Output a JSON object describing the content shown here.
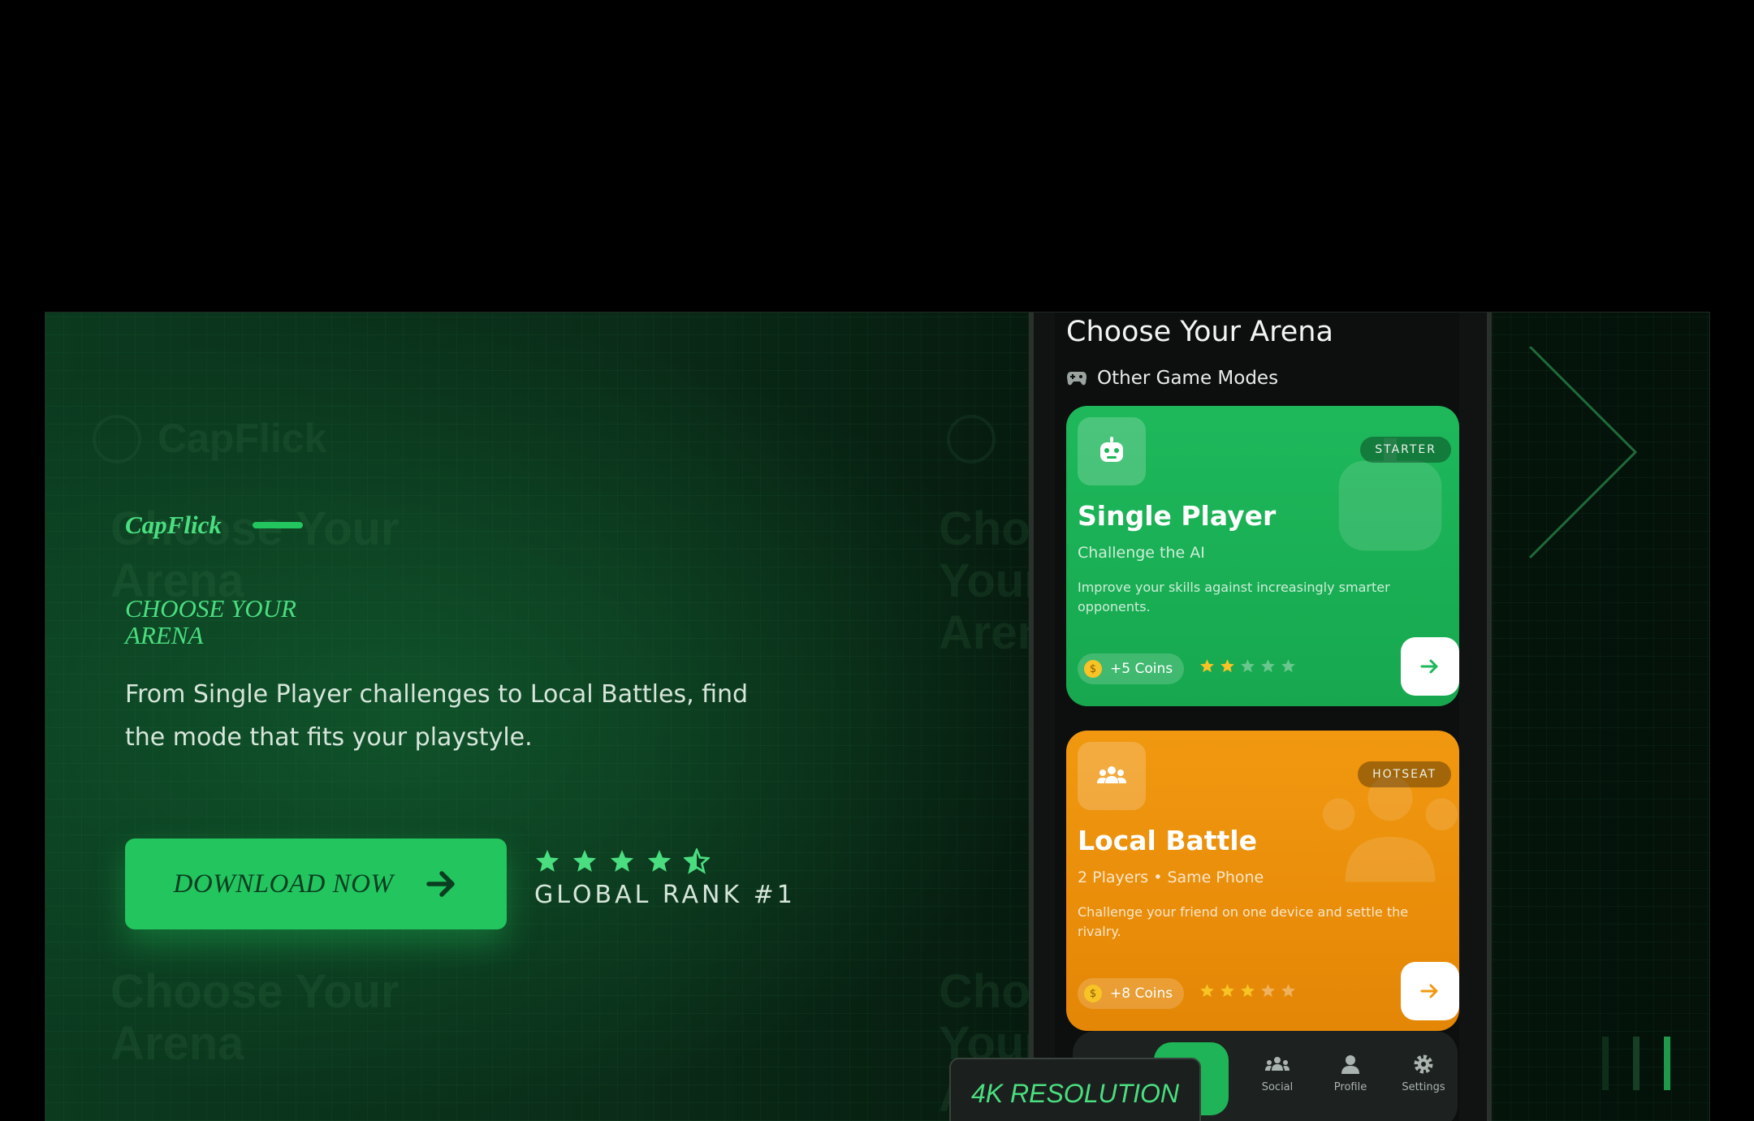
{
  "brand": {
    "name": "CapFlick"
  },
  "hero": {
    "title": "CHOOSE YOUR ARENA",
    "description": "From Single Player challenges to Local Battles, find the mode that fits your playstyle.",
    "download_label": "DOWNLOAD NOW",
    "rating_stars": 4.5,
    "rank_text": "GLOBAL RANK #1"
  },
  "ghost_text": {
    "brand": "CapFlick",
    "heading": "Choose Your Arena"
  },
  "phone": {
    "title": "Choose Your Arena",
    "subtitle": "Other Game Modes",
    "cards": [
      {
        "badge": "STARTER",
        "title": "Single Player",
        "tagline": "Challenge the AI",
        "description": "Improve your skills against increasingly smarter opponents.",
        "coins": "+5 Coins",
        "difficulty": 2,
        "difficulty_max": 5,
        "icon": "robot-icon"
      },
      {
        "badge": "HOTSEAT",
        "title": "Local Battle",
        "tagline": "2 Players • Same Phone",
        "description": "Challenge your friend on one device and settle the rivalry.",
        "coins": "+8 Coins",
        "difficulty": 3,
        "difficulty_max": 5,
        "icon": "users-icon"
      }
    ],
    "nav": [
      {
        "label": "Social",
        "icon": "social-icon"
      },
      {
        "label": "Profile",
        "icon": "profile-icon"
      },
      {
        "label": "Settings",
        "icon": "settings-icon"
      }
    ]
  },
  "badge": {
    "label": "4K RESOLUTION"
  },
  "colors": {
    "accent": "#22c55e",
    "accent_light": "#4ade80",
    "card_green": "#1eb85b",
    "card_orange": "#f19810",
    "star_gold": "#f7c325"
  }
}
